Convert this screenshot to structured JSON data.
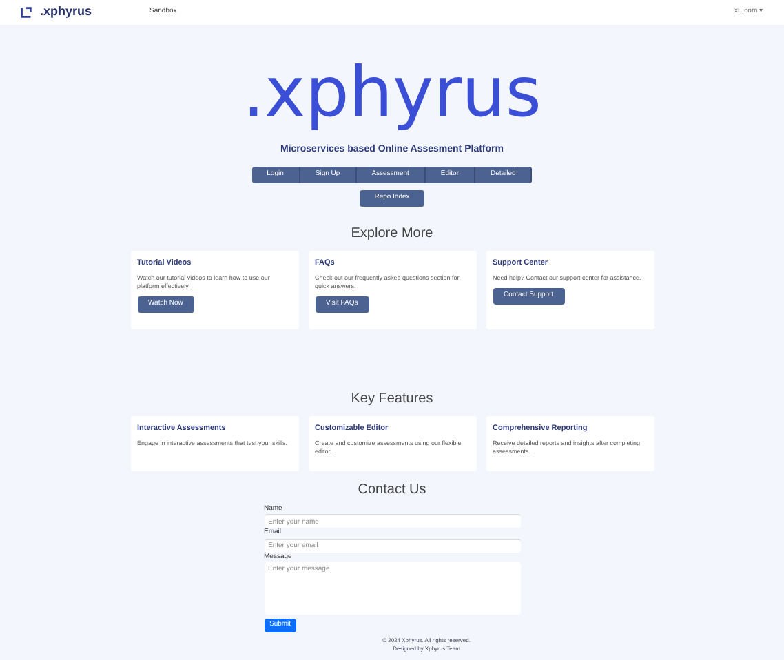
{
  "navbar": {
    "brand": ".xphyrus",
    "link": "Sandbox",
    "user": "xE.com ▾"
  },
  "hero": {
    "title": ".xphyrus",
    "subtitle": "Microservices based Online Assesment Platform",
    "buttons": [
      "Login",
      "Sign Up",
      "Assessment",
      "Editor",
      "Detailed"
    ],
    "extra_button": "Repo Index"
  },
  "explore": {
    "heading": "Explore More",
    "cards": [
      {
        "title": "Tutorial Videos",
        "text": "Watch our tutorial videos to learn how to use our platform effectively.",
        "button": "Watch Now"
      },
      {
        "title": "FAQs",
        "text": "Check out our frequently asked questions section for quick answers.",
        "button": "Visit FAQs"
      },
      {
        "title": "Support Center",
        "text": "Need help? Contact our support center for assistance.",
        "button": "Contact Support"
      }
    ]
  },
  "features": {
    "heading": "Key Features",
    "cards": [
      {
        "title": "Interactive Assessments",
        "text": "Engage in interactive assessments that test your skills."
      },
      {
        "title": "Customizable Editor",
        "text": "Create and customize assessments using our flexible editor."
      },
      {
        "title": "Comprehensive Reporting",
        "text": "Receive detailed reports and insights after completing assessments."
      }
    ]
  },
  "contact": {
    "heading": "Contact Us",
    "fields": [
      {
        "label": "Name",
        "placeholder": "Enter your name",
        "kind": "input"
      },
      {
        "label": "Email",
        "placeholder": "Enter your email",
        "kind": "input"
      },
      {
        "label": "Message",
        "placeholder": "Enter your message",
        "kind": "textarea"
      }
    ],
    "submit": "Submit"
  },
  "footer": [
    "© 2024 Xphyrus. All rights reserved.",
    "Designed by Xphyrus Team"
  ]
}
